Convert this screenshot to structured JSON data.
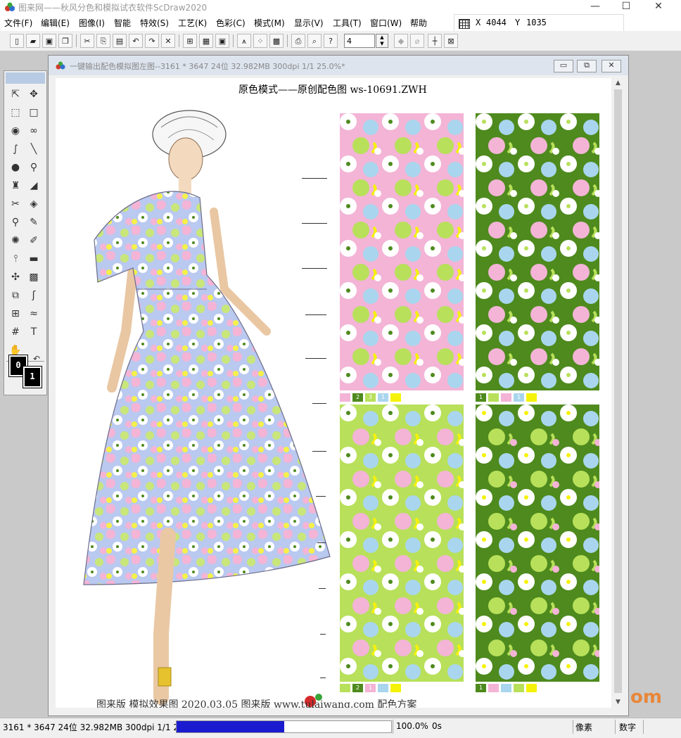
{
  "app": {
    "title": "图来网——秋风分色和模拟试衣软件ScDraw2020",
    "min_glyph": "—",
    "max_glyph": "☐",
    "close_glyph": "✕"
  },
  "menu": [
    "文件(F)",
    "编辑(E)",
    "图像(I)",
    "智能",
    "特效(S)",
    "工艺(K)",
    "色彩(C)",
    "模式(M)",
    "显示(V)",
    "工具(T)",
    "窗口(W)",
    "帮助"
  ],
  "coords": {
    "x_label": "X",
    "x_value": "4044",
    "y_label": "Y",
    "y_value": "1035"
  },
  "toolbar": {
    "zoom_value": "4",
    "icons": [
      "new-file-icon",
      "open-folder-icon",
      "save-icon",
      "save-all-icon",
      "cut-icon",
      "copy-icon",
      "paste-icon",
      "undo-icon",
      "redo-icon",
      "delete-icon",
      "grid-icon",
      "table-icon",
      "frame-icon",
      "mountain-icon",
      "dots-icon",
      "image-icon",
      "print-icon",
      "print-preview-icon",
      "help-icon"
    ]
  },
  "document": {
    "title": "一键输出配色模拟图左图--3161 * 3647 24位 32.982MB 300dpi 1/1 25.0%*",
    "heading": "原色模式——原创配色图 ws-10691.ZWH",
    "footer": "图来版    模拟效果图 2020.03.05              图来版 www.tulaiwang.com 配色方案"
  },
  "palettes": [
    {
      "colors": [
        "#f3b4d6",
        "#4e8a1d",
        "#b8e05a",
        "#a9d6ee",
        "#f5f20a"
      ],
      "labels": [
        "",
        "2",
        "3",
        "1",
        ""
      ],
      "background": "#f3b4d6"
    },
    {
      "colors": [
        "#4e8a1d",
        "#b8e05a",
        "#f3b4d6",
        "#a9d6ee",
        "#f5f20a"
      ],
      "labels": [
        "1",
        "",
        "",
        "1",
        ""
      ],
      "background": "#4e8a1d"
    },
    {
      "colors": [
        "#b8e05a",
        "#4e8a1d",
        "#f3b4d6",
        "#a9d6ee",
        "#f5f20a"
      ],
      "labels": [
        "",
        "2",
        "1",
        "",
        ""
      ],
      "background": "#b8e05a"
    },
    {
      "colors": [
        "#4e8a1d",
        "#f3b4d6",
        "#a9d6ee",
        "#b8e05a",
        "#f5f20a"
      ],
      "labels": [
        "1",
        "",
        "",
        "",
        ""
      ],
      "background": "#4e8a1d"
    }
  ],
  "foreground_swatch": "0",
  "background_swatch": "1",
  "status": {
    "info": "3161 * 3647 24位  32.982MB 300dpi 1/1  2",
    "progress": 0.5,
    "zoom": "100.0%",
    "time": "0s",
    "unit": "像素",
    "numlock": "数字"
  },
  "watermark": "om"
}
